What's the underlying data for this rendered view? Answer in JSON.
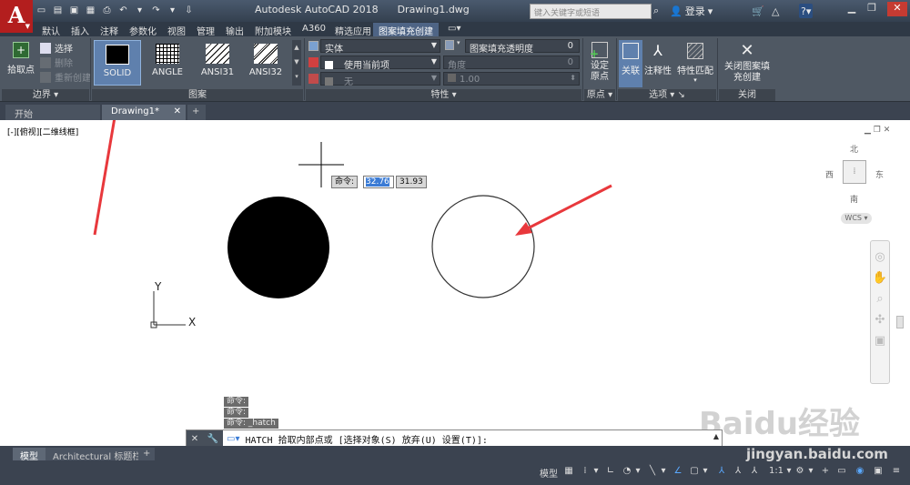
{
  "app": {
    "title": "Autodesk AutoCAD 2018",
    "document": "Drawing1.dwg",
    "search_placeholder": "键入关键字或短语",
    "login": "登录"
  },
  "ribbon_tabs": [
    "默认",
    "插入",
    "注释",
    "参数化",
    "视图",
    "管理",
    "输出",
    "附加模块",
    "A360",
    "精选应用",
    "图案填充创建"
  ],
  "active_ribbon_tab": "图案填充创建",
  "boundary_panel": {
    "pick_points": "拾取点",
    "select": "选择",
    "remove": "删除",
    "recreate": "重新创建",
    "label": "边界"
  },
  "pattern_panel": {
    "label": "图案",
    "patterns": [
      "SOLID",
      "ANGLE",
      "ANSI31",
      "ANSI32"
    ],
    "selected": "SOLID"
  },
  "properties_panel": {
    "label": "特性",
    "hatch_type": "实体",
    "color": "使用当前项",
    "background": "无",
    "transparency_label": "图案填充透明度",
    "transparency_value": "0",
    "angle_label": "角度",
    "angle_value": "0",
    "scale_value": "1.00"
  },
  "origin_panel": {
    "set_origin": "设定原点",
    "label": "原点"
  },
  "options_panel": {
    "associative": "关联",
    "annotative": "注释性",
    "match": "特性匹配",
    "label": "选项"
  },
  "close_panel": {
    "close_button": "关闭图案填充创建",
    "label": "关闭"
  },
  "doc_tabs": [
    "开始",
    "Drawing1*"
  ],
  "viewport_label": "[-][俯视][二维线框]",
  "viewcube": {
    "north": "北",
    "south": "南",
    "east": "东",
    "west": "西",
    "wcs": "WCS"
  },
  "dynamic_input": {
    "label": "命令:",
    "x": "32.76",
    "y": "31.93"
  },
  "ucs": {
    "x_label": "X",
    "y_label": "Y"
  },
  "command_history": [
    "命令:",
    "命令:",
    "命令: _hatch"
  ],
  "command_line": "HATCH 拾取内部点或 [选择对象(S) 放弃(U) 设置(T)]:",
  "layout_tabs": [
    "模型",
    "Architectural 标题栏"
  ],
  "status": {
    "model": "模型",
    "scale": "1:1"
  },
  "watermark": {
    "brand": "Baidu经验",
    "url": "jingyan.baidu.com"
  },
  "colors": {
    "accent": "#5f80ad",
    "logo": "#b31e1e",
    "arrow": "#e8383c"
  }
}
